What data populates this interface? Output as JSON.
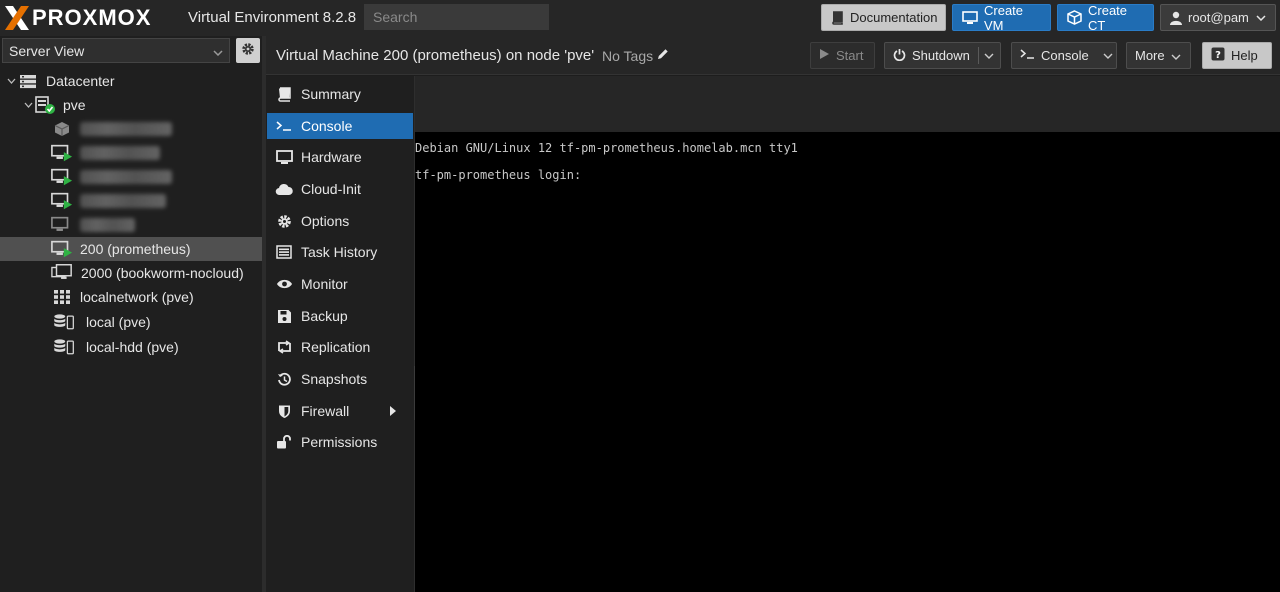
{
  "topbar": {
    "logo": "PROXMOX",
    "app_title": "Virtual Environment 8.2.8",
    "search_placeholder": "Search",
    "buttons": {
      "documentation": "Documentation",
      "create_vm": "Create VM",
      "create_ct": "Create CT",
      "user": "root@pam"
    }
  },
  "left": {
    "view_selector": "Server View",
    "tree": [
      {
        "label": "Datacenter",
        "icon": "server-rack-icon"
      },
      {
        "label": "pve",
        "icon": "node-online-icon"
      },
      {
        "label": "",
        "icon": "container-icon",
        "blurred": true
      },
      {
        "label": "",
        "icon": "vm-running-icon",
        "blurred": true
      },
      {
        "label": "",
        "icon": "vm-running-icon",
        "blurred": true
      },
      {
        "label": "",
        "icon": "vm-running-icon",
        "blurred": true
      },
      {
        "label": "",
        "icon": "vm-stopped-icon",
        "blurred": true
      },
      {
        "label": "200 (prometheus)",
        "icon": "vm-running-icon",
        "selected": true
      },
      {
        "label": "2000 (bookworm-nocloud)",
        "icon": "vm-template-icon"
      },
      {
        "label": "localnetwork (pve)",
        "icon": "network-grid-icon"
      },
      {
        "label": "local (pve)",
        "icon": "storage-icon"
      },
      {
        "label": "local-hdd (pve)",
        "icon": "storage-icon"
      }
    ]
  },
  "main": {
    "title": "Virtual Machine 200 (prometheus) on node 'pve'",
    "tags": "No Tags",
    "buttons": {
      "start": "Start",
      "shutdown": "Shutdown",
      "console": "Console",
      "more": "More",
      "help": "Help"
    },
    "nav": [
      {
        "label": "Summary",
        "icon": "book-icon"
      },
      {
        "label": "Console",
        "icon": "terminal-icon",
        "active": true
      },
      {
        "label": "Hardware",
        "icon": "monitor-icon"
      },
      {
        "label": "Cloud-Init",
        "icon": "cloud-icon"
      },
      {
        "label": "Options",
        "icon": "gear-icon"
      },
      {
        "label": "Task History",
        "icon": "list-icon"
      },
      {
        "label": "Monitor",
        "icon": "eye-icon"
      },
      {
        "label": "Backup",
        "icon": "floppy-icon"
      },
      {
        "label": "Replication",
        "icon": "retweet-icon"
      },
      {
        "label": "Snapshots",
        "icon": "history-icon"
      },
      {
        "label": "Firewall",
        "icon": "shield-icon"
      },
      {
        "label": "Permissions",
        "icon": "unlock-icon"
      }
    ],
    "terminal": {
      "line1": "Debian GNU/Linux 12 tf-pm-prometheus.homelab.mcn tty1",
      "line2": "tf-pm-prometheus login:"
    }
  },
  "colors": {
    "accent": "#1f6cb2",
    "running_green": "#2fb344",
    "logo_orange": "#e57000"
  }
}
